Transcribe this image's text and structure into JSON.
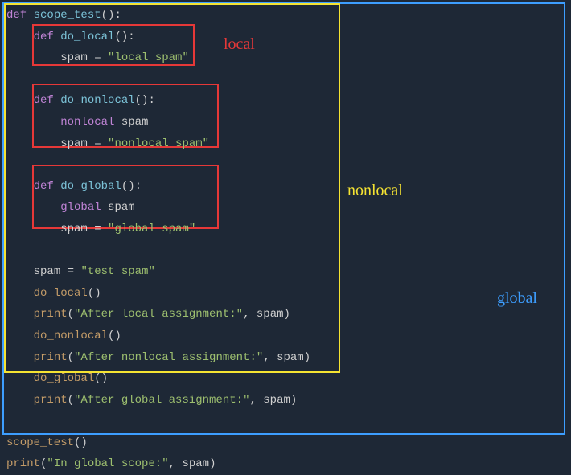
{
  "labels": {
    "local": "local",
    "nonlocal": "nonlocal",
    "global": "global"
  },
  "code": {
    "l1_def": "def",
    "l1_fn": "scope_test",
    "l2_def": "def",
    "l2_fn": "do_local",
    "l3_var": "spam",
    "l3_eq": "=",
    "l3_str": "\"local spam\"",
    "l4_def": "def",
    "l4_fn": "do_nonlocal",
    "l5_kw": "nonlocal",
    "l5_var": "spam",
    "l6_var": "spam",
    "l6_eq": "=",
    "l6_str": "\"nonlocal spam\"",
    "l7_def": "def",
    "l7_fn": "do_global",
    "l8_kw": "global",
    "l8_var": "spam",
    "l9_var": "spam",
    "l9_eq": "=",
    "l9_str": "\"global spam\"",
    "l10_var": "spam",
    "l10_eq": "=",
    "l10_str": "\"test spam\"",
    "l11_call": "do_local",
    "l12_fn": "print",
    "l12_str": "\"After local assignment:\"",
    "l12_arg": "spam",
    "l13_call": "do_nonlocal",
    "l14_fn": "print",
    "l14_str": "\"After nonlocal assignment:\"",
    "l14_arg": "spam",
    "l15_call": "do_global",
    "l16_fn": "print",
    "l16_str": "\"After global assignment:\"",
    "l16_arg": "spam",
    "l17_call": "scope_test",
    "l18_fn": "print",
    "l18_str": "\"In global scope:\"",
    "l18_arg": "spam"
  }
}
